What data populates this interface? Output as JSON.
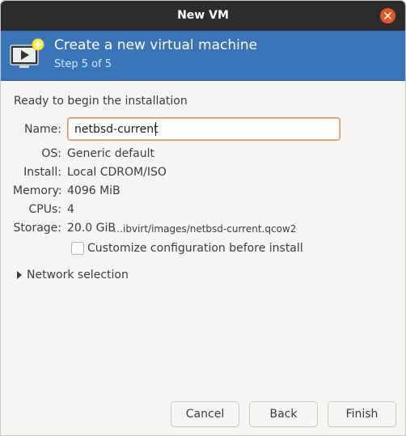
{
  "window": {
    "title": "New VM",
    "close_icon": "close-icon"
  },
  "banner": {
    "heading": "Create a new virtual machine",
    "step": "Step 5 of 5",
    "icon": "vm-monitor-icon"
  },
  "summary": {
    "ready_text": "Ready to begin the installation",
    "name_label": "Name:",
    "name_value": "netbsd-current",
    "os_label": "OS:",
    "os_value": "Generic default",
    "install_label": "Install:",
    "install_value": "Local CDROM/ISO",
    "memory_label": "Memory:",
    "memory_value": "4096 MiB",
    "cpus_label": "CPUs:",
    "cpus_value": "4",
    "storage_label": "Storage:",
    "storage_size": "20.0 GiB",
    "storage_path": "…ibvirt/images/netbsd-current.qcow2",
    "customize_label": "Customize configuration before install",
    "customize_checked": false
  },
  "network": {
    "label": "Network selection",
    "expanded": false
  },
  "buttons": {
    "cancel": "Cancel",
    "back": "Back",
    "finish": "Finish"
  },
  "colors": {
    "titlebar": "#2c2c2c",
    "banner": "#3874b7",
    "close": "#e95420",
    "input_focus": "#e98c61"
  }
}
